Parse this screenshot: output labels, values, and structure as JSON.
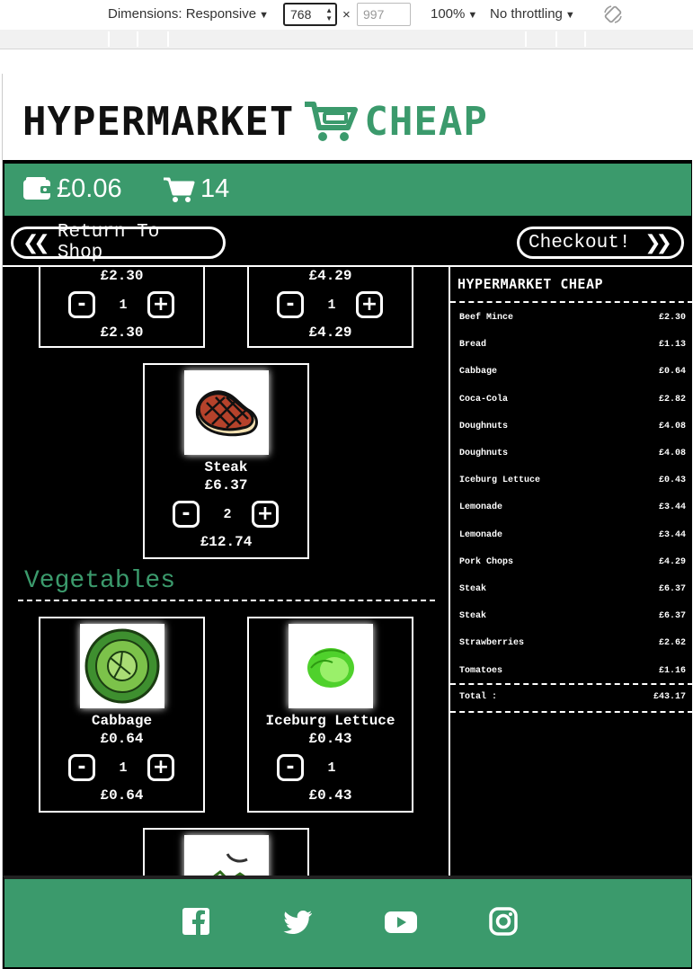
{
  "devtools": {
    "dimensions_label": "Dimensions: Responsive",
    "width_value": "768",
    "height_placeholder": "997",
    "times": "×",
    "zoom": "100%",
    "throttling": "No throttling"
  },
  "brand": {
    "part1": "HYPERMARKET",
    "part2": "CHEAP"
  },
  "topbar": {
    "wallet_amount": "£0.06",
    "cart_count": "14"
  },
  "nav": {
    "back_label": "Return To Shop",
    "checkout_label": "Checkout!"
  },
  "products": {
    "partial_row": [
      {
        "price": "£2.30",
        "qty": "1",
        "total": "£2.30"
      },
      {
        "price": "£4.29",
        "qty": "1",
        "total": "£4.29"
      }
    ],
    "steak": {
      "name": "Steak",
      "price": "£6.37",
      "qty": "2",
      "total": "£12.74"
    },
    "vegetables_title": "Vegetables",
    "vegetables": [
      {
        "name": "Cabbage",
        "price": "£0.64",
        "qty": "1",
        "total": "£0.64"
      },
      {
        "name": "Iceburg Lettuce",
        "price": "£0.43",
        "qty": "1",
        "total": "£0.43"
      }
    ],
    "minus": "-",
    "plus": "+"
  },
  "receipt": {
    "logo": "HYPERMARKET CHEAP",
    "items": [
      {
        "name": "Beef Mince",
        "price": "£2.30"
      },
      {
        "name": "Bread",
        "price": "£1.13"
      },
      {
        "name": "Cabbage",
        "price": "£0.64"
      },
      {
        "name": "Coca-Cola",
        "price": "£2.82"
      },
      {
        "name": "Doughnuts",
        "price": "£4.08"
      },
      {
        "name": "Doughnuts",
        "price": "£4.08"
      },
      {
        "name": "Iceburg Lettuce",
        "price": "£0.43"
      },
      {
        "name": "Lemonade",
        "price": "£3.44"
      },
      {
        "name": "Lemonade",
        "price": "£3.44"
      },
      {
        "name": "Pork Chops",
        "price": "£4.29"
      },
      {
        "name": "Steak",
        "price": "£6.37"
      },
      {
        "name": "Steak",
        "price": "£6.37"
      },
      {
        "name": "Strawberries",
        "price": "£2.62"
      },
      {
        "name": "Tomatoes",
        "price": "£1.16"
      }
    ],
    "total_label": "Total :",
    "total_value": "£43.17"
  },
  "footer": {
    "icons": [
      "facebook-icon",
      "twitter-icon",
      "youtube-icon",
      "instagram-icon"
    ]
  },
  "colors": {
    "brand_green": "#3b9a6c",
    "background": "#000000",
    "text": "#ffffff"
  }
}
